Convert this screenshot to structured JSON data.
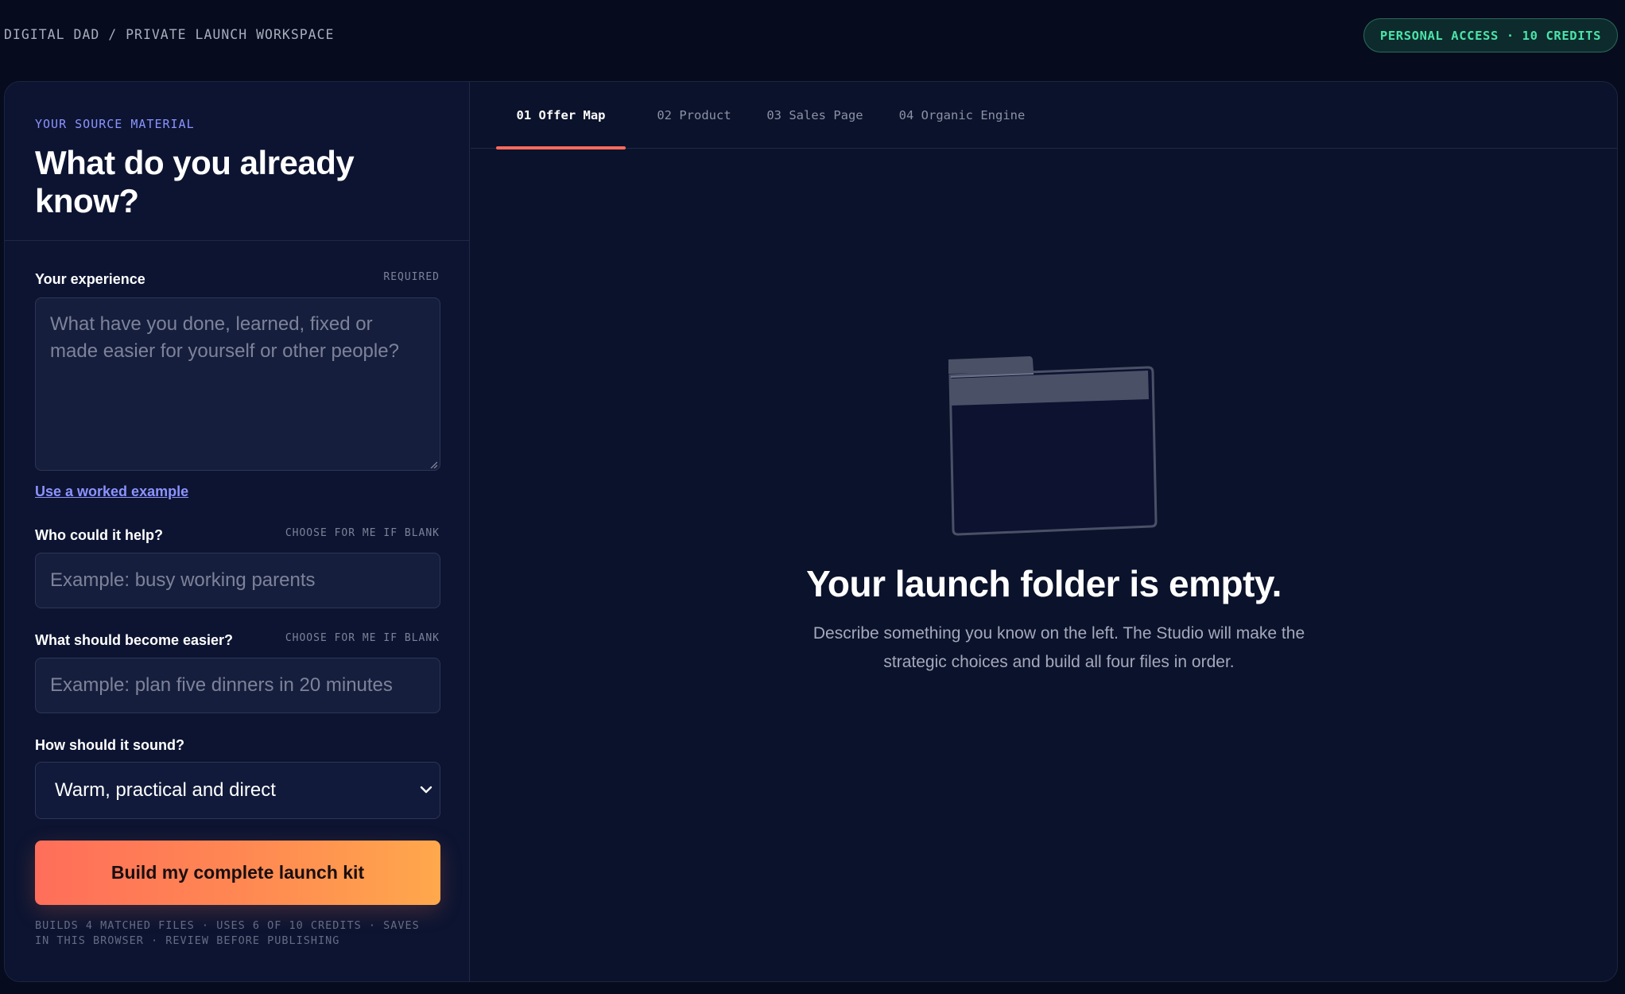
{
  "header": {
    "breadcrumb": "DIGITAL DAD / PRIVATE LAUNCH WORKSPACE",
    "badge": "PERSONAL ACCESS · 10 CREDITS"
  },
  "left_panel": {
    "eyebrow": "YOUR SOURCE MATERIAL",
    "title": "What do you already know?",
    "experience": {
      "label": "Your experience",
      "hint": "REQUIRED",
      "placeholder": "What have you done, learned, fixed or made easier for yourself or other people?",
      "value": ""
    },
    "worked_example_link": "Use a worked example",
    "audience": {
      "label": "Who could it help?",
      "hint": "CHOOSE FOR ME IF BLANK",
      "placeholder": "Example: busy working parents",
      "value": ""
    },
    "outcome": {
      "label": "What should become easier?",
      "hint": "CHOOSE FOR ME IF BLANK",
      "placeholder": "Example: plan five dinners in 20 minutes",
      "value": ""
    },
    "tone": {
      "label": "How should it sound?",
      "selected": "Warm, practical and direct"
    },
    "cta_label": "Build my complete launch kit",
    "footnote": "BUILDS 4 MATCHED FILES · USES 6 OF 10 CREDITS · SAVES IN THIS BROWSER · REVIEW BEFORE PUBLISHING"
  },
  "tabs": [
    {
      "label": "01 Offer Map",
      "active": true
    },
    {
      "label": "02 Product",
      "active": false
    },
    {
      "label": "03 Sales Page",
      "active": false
    },
    {
      "label": "04 Organic Engine",
      "active": false
    }
  ],
  "empty_state": {
    "icon": "folder-icon",
    "title": "Your launch folder is empty.",
    "description": "Describe something you know on the left. The Studio will make the strategic choices and build all four files in order."
  },
  "colors": {
    "background": "#070b1e",
    "panel": "#0c1431",
    "accent_violet": "#8d93ff",
    "accent_green": "#4be3a9",
    "tab_underline": "#ff6a5c",
    "cta_gradient_start": "#ff6e5a",
    "cta_gradient_end": "#ffa84c"
  }
}
